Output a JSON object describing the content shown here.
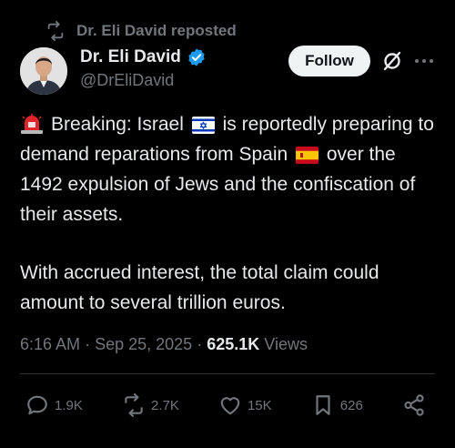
{
  "repost": {
    "text": "Dr. Eli David reposted",
    "icon": "repost-icon"
  },
  "author": {
    "name": "Dr. Eli David",
    "handle": "@DrEliDavid",
    "verified": true,
    "verified_color": "#1d9bf0"
  },
  "follow_button": {
    "label": "Follow"
  },
  "tweet": {
    "p1_part1": "Breaking: Israel",
    "p1_part2": "is reportedly preparing to demand reparations from Spain",
    "p1_part3": "over the 1492 expulsion of Jews and the confiscation of their assets.",
    "p2": "With accrued interest, the total claim could amount to several trillion euros."
  },
  "meta": {
    "time": "6:16 AM",
    "date": "Sep 25, 2025",
    "views_count": "625.1K",
    "views_label": "Views"
  },
  "actions": {
    "replies": "1.9K",
    "reposts": "2.7K",
    "likes": "15K",
    "bookmarks": "626"
  },
  "colors": {
    "background": "#000000",
    "text": "#e7e9ea",
    "muted": "#71767b"
  }
}
